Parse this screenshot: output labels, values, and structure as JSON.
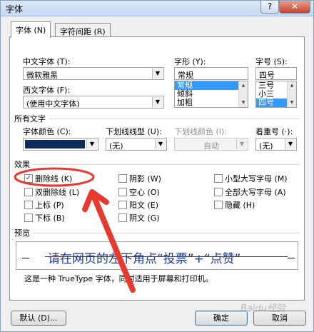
{
  "dialog": {
    "title": "字体",
    "help_label": "?",
    "close_label": "✕"
  },
  "tabs": [
    {
      "label": "字体 (N)"
    },
    {
      "label": "字符间距 (R)"
    }
  ],
  "fonts": {
    "chinese_label": "中文字体 (T):",
    "chinese_value": "微软雅黑",
    "western_label": "西文字体 (F):",
    "western_value": "(使用中文字体)"
  },
  "style": {
    "label": "字形 (Y):",
    "value": "常规",
    "options": [
      "常规",
      "倾斜",
      "加粗"
    ],
    "selected": "常规"
  },
  "size": {
    "label": "字号 (S):",
    "value": "四号",
    "options": [
      "三号",
      "小三",
      "四号"
    ],
    "selected": "四号"
  },
  "all_text": {
    "section_label": "所有文字",
    "font_color_label": "字体颜色 (C):",
    "font_color_value": "#0f2a5c",
    "underline_style_label": "下划线线型 (U):",
    "underline_style_value": "(无)",
    "underline_color_label": "下划线颜色 (I):",
    "underline_color_value": "自动",
    "emphasis_label": "着重号 (·):",
    "emphasis_value": "(无)"
  },
  "effects": {
    "section_label": "效果",
    "items": [
      {
        "label": "删除线 (K)",
        "checked": "✓"
      },
      {
        "label": "双删除线 (L)",
        "checked": ""
      },
      {
        "label": "上标 (P)",
        "checked": ""
      },
      {
        "label": "下标 (B)",
        "checked": ""
      },
      {
        "label": "阴影 (W)",
        "checked": ""
      },
      {
        "label": "空心 (O)",
        "checked": ""
      },
      {
        "label": "阳文 (E)",
        "checked": ""
      },
      {
        "label": "阴文 (G)",
        "checked": ""
      },
      {
        "label": "小型大写字母 (M)",
        "checked": ""
      },
      {
        "label": "全部大写字母 (A)",
        "checked": ""
      },
      {
        "label": "隐藏 (H)",
        "checked": ""
      }
    ]
  },
  "preview": {
    "section_label": "预览",
    "sample_text": "请在网页的左下角点“投票”+“点赞”",
    "note": "这是一种 TrueType 字体，同时适用于屏幕和打印机。"
  },
  "buttons": {
    "default_label": "默认 (D)...",
    "ok_label": "确定",
    "cancel_label": "取消"
  },
  "watermark": "Baidu经验",
  "annotation": {
    "color": "#e8392f"
  }
}
